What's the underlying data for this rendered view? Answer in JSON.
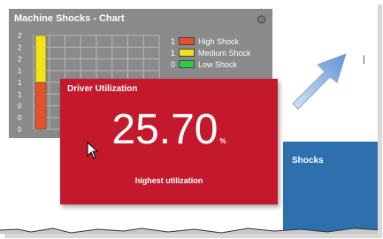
{
  "chart_tile": {
    "title": "Machine Shocks - Chart",
    "y_ticks": [
      "2",
      "2",
      "2",
      "1",
      "1",
      "1",
      "0",
      "0",
      "0"
    ],
    "legend": [
      {
        "count": "1",
        "label": "High Shock",
        "color": "#e8502a"
      },
      {
        "count": "1",
        "label": "Medium Shock",
        "color": "#f2e21a"
      },
      {
        "count": "0",
        "label": "Low Shock",
        "color": "#2ecc40"
      }
    ]
  },
  "chart_data": {
    "type": "bar",
    "categories": [
      ""
    ],
    "series": [
      {
        "name": "High Shock",
        "values": [
          1
        ]
      },
      {
        "name": "Medium Shock",
        "values": [
          1
        ]
      },
      {
        "name": "Low Shock",
        "values": [
          0
        ]
      }
    ],
    "ylim": [
      0,
      2
    ],
    "stacked": true,
    "grid": true,
    "legend_position": "right"
  },
  "utilization_tile": {
    "title": "Driver Utilization",
    "value": "25.70",
    "unit": "%",
    "subtitle": "highest utilization",
    "color": "#c4182d"
  },
  "blue_tile": {
    "title": "Shocks",
    "color": "#2e6fae"
  },
  "icons": {
    "gear": "gear-icon",
    "arrow": "arrow-icon",
    "cursor": "cursor-icon"
  }
}
